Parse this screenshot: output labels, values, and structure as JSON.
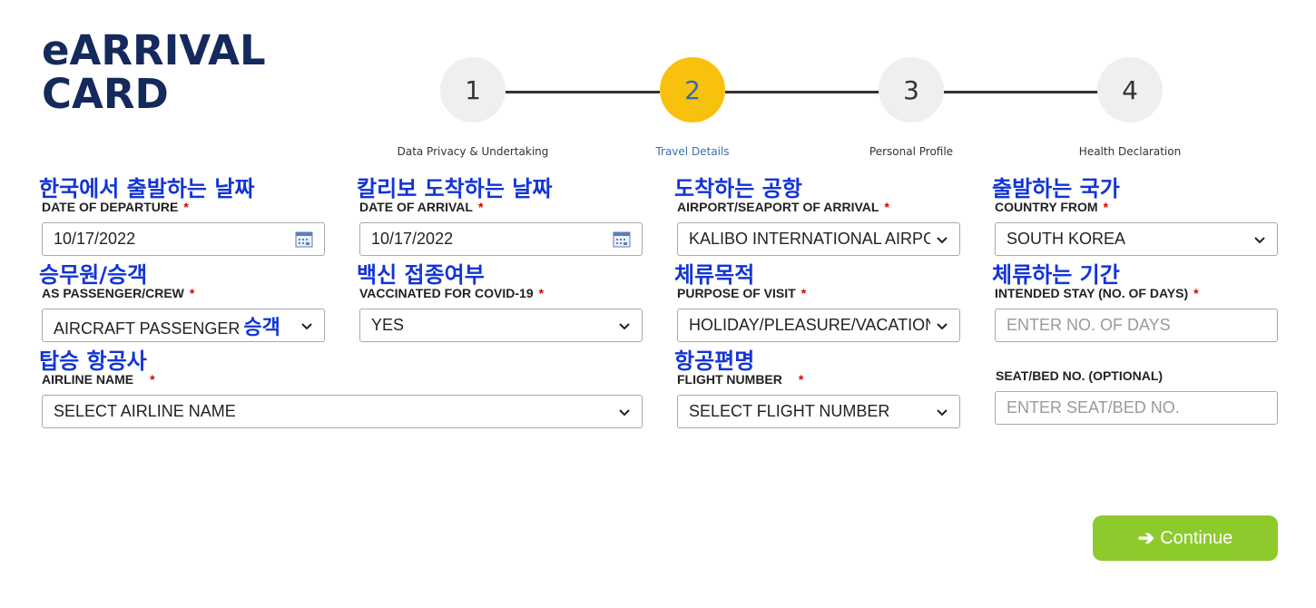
{
  "logo": {
    "line1": "eARRIVAL",
    "line2": "CARD"
  },
  "steps": [
    {
      "number": "1",
      "label": "Data Privacy & Undertaking"
    },
    {
      "number": "2",
      "label": "Travel Details"
    },
    {
      "number": "3",
      "label": "Personal Profile"
    },
    {
      "number": "4",
      "label": "Health Declaration"
    }
  ],
  "active_step": "2",
  "colors": {
    "active_step": "#f8c10d",
    "annotation": "#1235d4",
    "continue": "#8ccb2b",
    "required": "#d40000"
  },
  "fields": {
    "departure": {
      "annotation": "한국에서 출발하는 날짜",
      "label": "DATE OF DEPARTURE",
      "required": "*",
      "value": "10/17/2022",
      "icon": "calendar-icon"
    },
    "arrival": {
      "annotation": "칼리보 도착하는 날짜",
      "label": "DATE OF ARRIVAL",
      "required": "*",
      "value": "10/17/2022",
      "icon": "calendar-icon"
    },
    "airport": {
      "annotation": "도착하는 공항",
      "label": "AIRPORT/SEAPORT OF ARRIVAL",
      "required": "*",
      "value": "KALIBO INTERNATIONAL AIRPOI"
    },
    "country": {
      "annotation": "출발하는 국가",
      "label": "COUNTRY FROM",
      "required": "*",
      "value": "SOUTH KOREA"
    },
    "passenger": {
      "annotation": "승무원/승객",
      "label": "AS PASSENGER/CREW",
      "required": "*",
      "value": "AIRCRAFT PASSENGER",
      "value_annotation": "승객"
    },
    "vaccinated": {
      "annotation": "백신 접종여부",
      "label": "VACCINATED FOR COVID-19",
      "required": "*",
      "value": "YES"
    },
    "purpose": {
      "annotation": "체류목적",
      "label": "PURPOSE OF VISIT",
      "required": "*",
      "value": "HOLIDAY/PLEASURE/VACATION"
    },
    "stay": {
      "annotation": "체류하는 기간",
      "label": "INTENDED STAY (NO. OF DAYS)",
      "required": "*",
      "placeholder": "ENTER NO. OF DAYS"
    },
    "airline": {
      "annotation": "탑승 항공사",
      "label": "AIRLINE NAME",
      "required": "*",
      "value": "SELECT AIRLINE NAME"
    },
    "flight": {
      "annotation": "항공편명",
      "label": "FLIGHT NUMBER",
      "required": "*",
      "value": "SELECT FLIGHT NUMBER"
    },
    "seat": {
      "label": "SEAT/BED NO. (OPTIONAL)",
      "placeholder": "ENTER SEAT/BED NO."
    }
  },
  "continue_button": {
    "label": "Continue",
    "icon": "arrow-right-icon"
  }
}
